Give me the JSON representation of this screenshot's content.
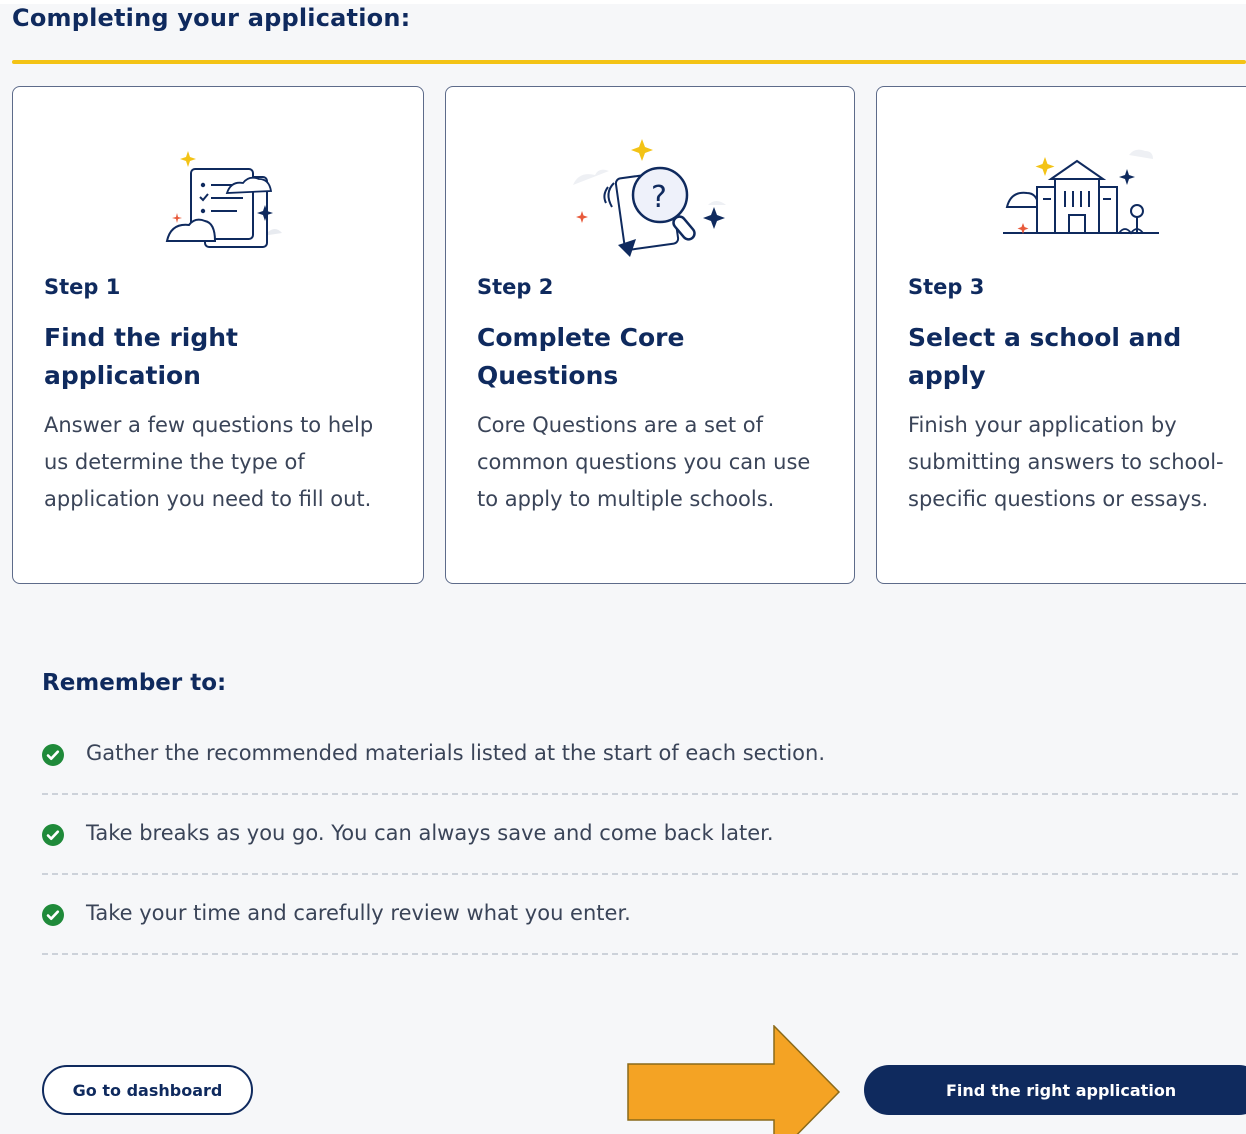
{
  "page": {
    "heading": "Completing your application:"
  },
  "steps": [
    {
      "step_label": "Step 1",
      "title": "Find the right application",
      "description": "Answer a few questions to help us determine the type of application you need to fill out.",
      "icon": "checklist-illustration-icon"
    },
    {
      "step_label": "Step 2",
      "title": "Complete Core Questions",
      "description": "Core Questions are a set of common questions you can use to apply to multiple schools.",
      "icon": "question-magnifier-illustration-icon"
    },
    {
      "step_label": "Step 3",
      "title": "Select a school and apply",
      "description": "Finish your application by submitting answers to school-specific questions or essays.",
      "icon": "school-building-illustration-icon"
    }
  ],
  "remember": {
    "heading": "Remember to:",
    "items": [
      "Gather the recommended materials listed at the start of each section.",
      "Take breaks as you go. You can always save and come back later.",
      "Take your time and carefully review what you enter."
    ]
  },
  "actions": {
    "dashboard_label": "Go to dashboard",
    "primary_label": "Find the right application"
  },
  "colors": {
    "navy": "#0f2a5e",
    "accent_yellow": "#f3c316",
    "check_green": "#1f8a3a",
    "arrow_orange": "#f4a324",
    "background": "#f6f7f9"
  }
}
